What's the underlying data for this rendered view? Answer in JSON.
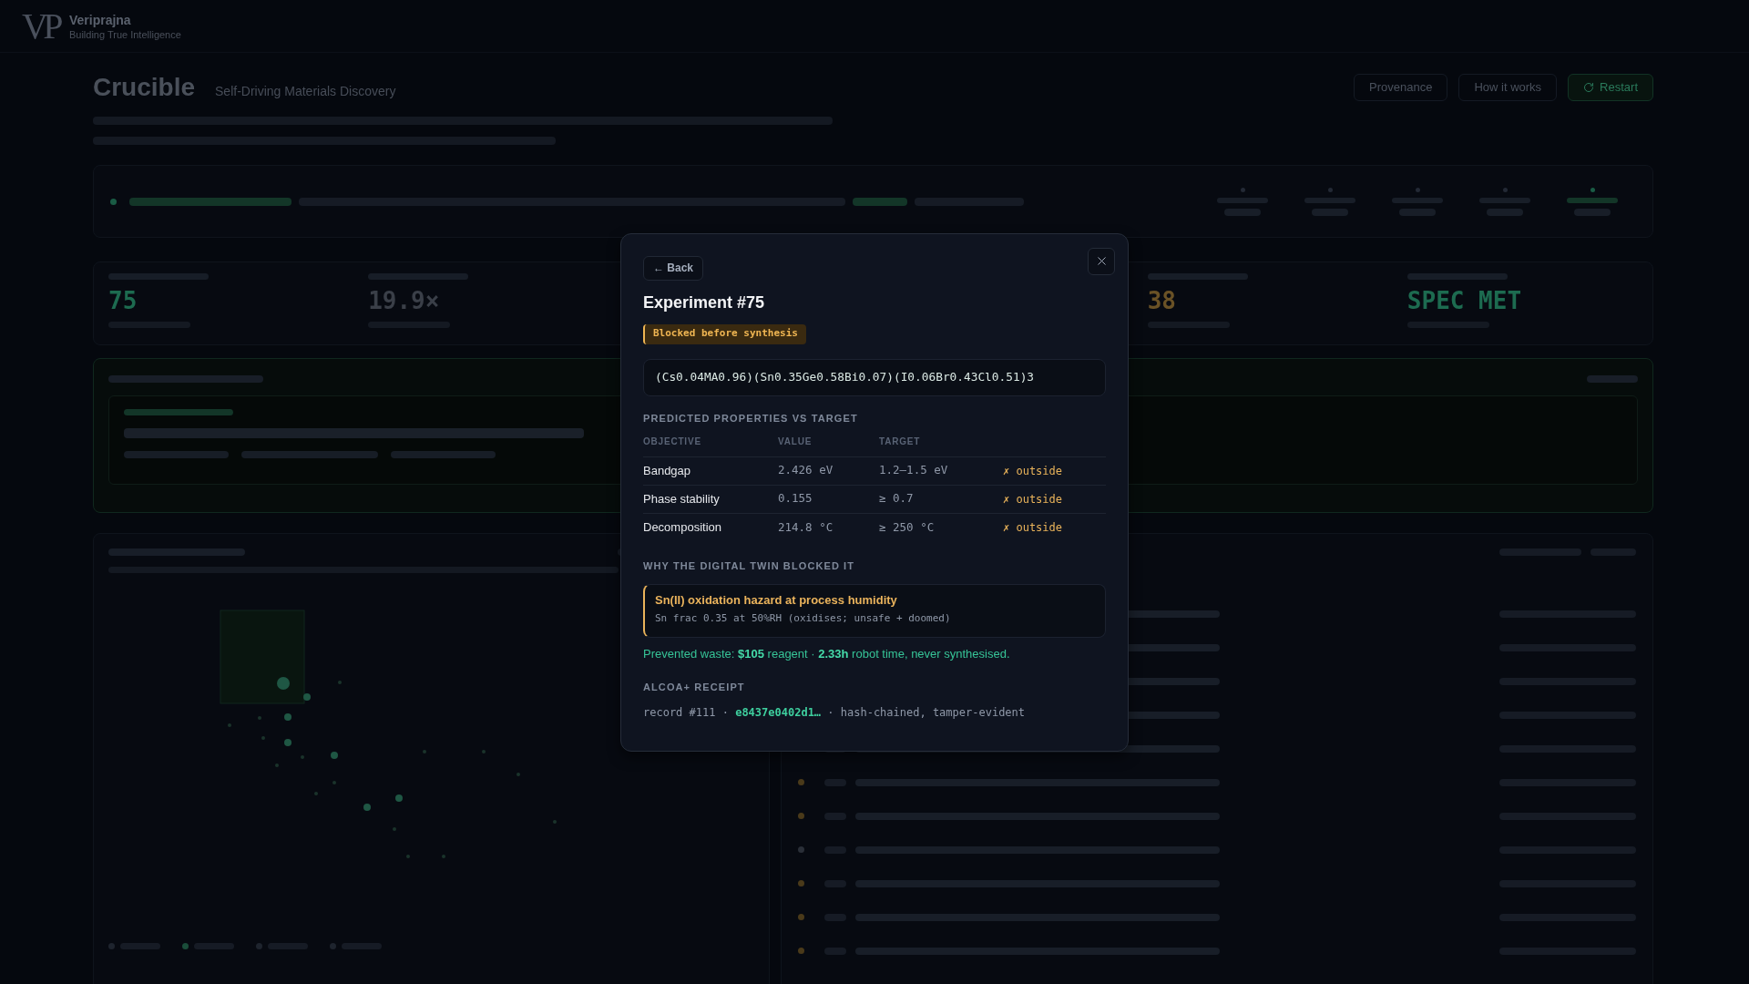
{
  "backdrop": {
    "brand": {
      "logo": "VP",
      "name": "Veriprajna",
      "tagline": "Building True Intelligence"
    },
    "header": {
      "title": "Crucible",
      "subtitle": "Self-Driving Materials Discovery",
      "buttons": [
        {
          "label": "Provenance",
          "kind": "outline"
        },
        {
          "label": "How it works",
          "kind": "outline"
        },
        {
          "label": "Restart",
          "kind": "primary"
        }
      ]
    },
    "stats": [
      {
        "value": "75",
        "color": "#1d6b50"
      },
      {
        "value": "19.9×",
        "color": "#3a3f48"
      },
      {
        "value": "38",
        "color": "#6a5226"
      },
      {
        "value": "SPEC MET",
        "color": "#1d6b50"
      }
    ],
    "runs": [
      {
        "color": "#4a3a1a"
      },
      {
        "color": "#4a3a1a"
      },
      {
        "color": "#2a2f38"
      },
      {
        "color": "#4a3a1a"
      },
      {
        "color": "#4a3a1a"
      },
      {
        "color": "#4a3a1a"
      }
    ]
  },
  "dialog": {
    "back_button": "← Back",
    "title": "Experiment #75",
    "status": {
      "label": "Blocked before synthesis",
      "kind": "blocked"
    },
    "formula": "(Cs0.04MA0.96)(Sn0.35Ge0.58Bi0.07)(I0.06Br0.43Cl0.51)3",
    "properties": {
      "heading": "PREDICTED PROPERTIES VS TARGET",
      "columns": [
        "OBJECTIVE",
        "VALUE",
        "TARGET"
      ],
      "rows": [
        {
          "objective": "Bandgap",
          "value": "2.426 eV",
          "target": "1.2–1.5 eV",
          "verdict": "✗ outside",
          "within": false
        },
        {
          "objective": "Phase stability",
          "value": "0.155",
          "target": "≥ 0.7",
          "verdict": "✗ outside",
          "within": false
        },
        {
          "objective": "Decomposition",
          "value": "214.8 °C",
          "target": "≥ 250 °C",
          "verdict": "✗ outside",
          "within": false
        }
      ]
    },
    "block_reason": {
      "heading": "WHY THE DIGITAL TWIN BLOCKED IT",
      "title": "Sn(II) oxidation hazard at process humidity",
      "detail": "Sn frac 0.35 at 50%RH (oxidises; unsafe + doomed)"
    },
    "savings": "Prevented waste: **$105** reagent · **2.33h** robot time, never synthesised.",
    "receipt": {
      "heading": "ALCOA+ RECEIPT",
      "line": "record #111 · **e8437e0402d1…** · hash-chained, tamper-evident"
    }
  }
}
